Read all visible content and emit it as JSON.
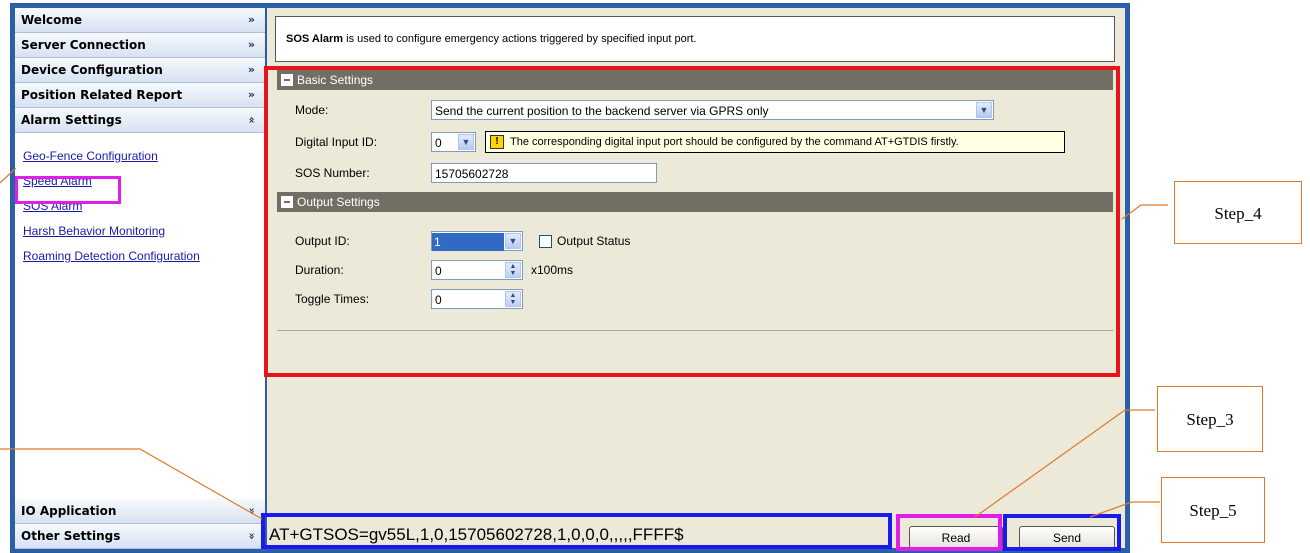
{
  "sidebar": {
    "headers_top": [
      {
        "label": "Welcome"
      },
      {
        "label": "Server Connection"
      },
      {
        "label": "Device Configuration"
      },
      {
        "label": "Position Related Report"
      },
      {
        "label": "Alarm Settings"
      }
    ],
    "alarm_links": [
      {
        "label": "Geo-Fence Configuration"
      },
      {
        "label": "Speed Alarm"
      },
      {
        "label": "SOS Alarm"
      },
      {
        "label": "Harsh Behavior Monitoring"
      },
      {
        "label": "Roaming Detection Configuration"
      }
    ],
    "headers_bottom": [
      {
        "label": "IO Application"
      },
      {
        "label": "Other Settings"
      }
    ],
    "chevron_down": "»",
    "chevron_up": "«"
  },
  "main": {
    "description_bold": "SOS Alarm",
    "description_text": "is used to configure emergency actions triggered by specified input port.",
    "basic": {
      "title": "Basic Settings",
      "mode_label": "Mode:",
      "mode_value": "Send the current position to the backend server via GPRS only",
      "digital_input_label": "Digital Input ID:",
      "digital_input_value": "0",
      "hint_text": "The corresponding digital input port should be configured by the command AT+GTDIS firstly.",
      "sos_number_label": "SOS Number:",
      "sos_number_value": "15705602728"
    },
    "output": {
      "title": "Output Settings",
      "output_id_label": "Output ID:",
      "output_id_value": "1",
      "output_status_label": "Output Status",
      "duration_label": "Duration:",
      "duration_value": "0",
      "duration_unit": "x100ms",
      "toggle_label": "Toggle Times:",
      "toggle_value": "0"
    },
    "command": "AT+GTSOS=gv55L,1,0,15705602728,1,0,0,0,,,,,FFFF$",
    "read_button": "Read",
    "send_button": "Send"
  },
  "annotations": {
    "step4": "Step_4",
    "step3": "Step_3",
    "step5": "Step_5",
    "colors": {
      "red": "#e8141b",
      "magenta": "#e11ee8",
      "blue": "#1a1aee",
      "orange": "#e07a2a"
    }
  }
}
